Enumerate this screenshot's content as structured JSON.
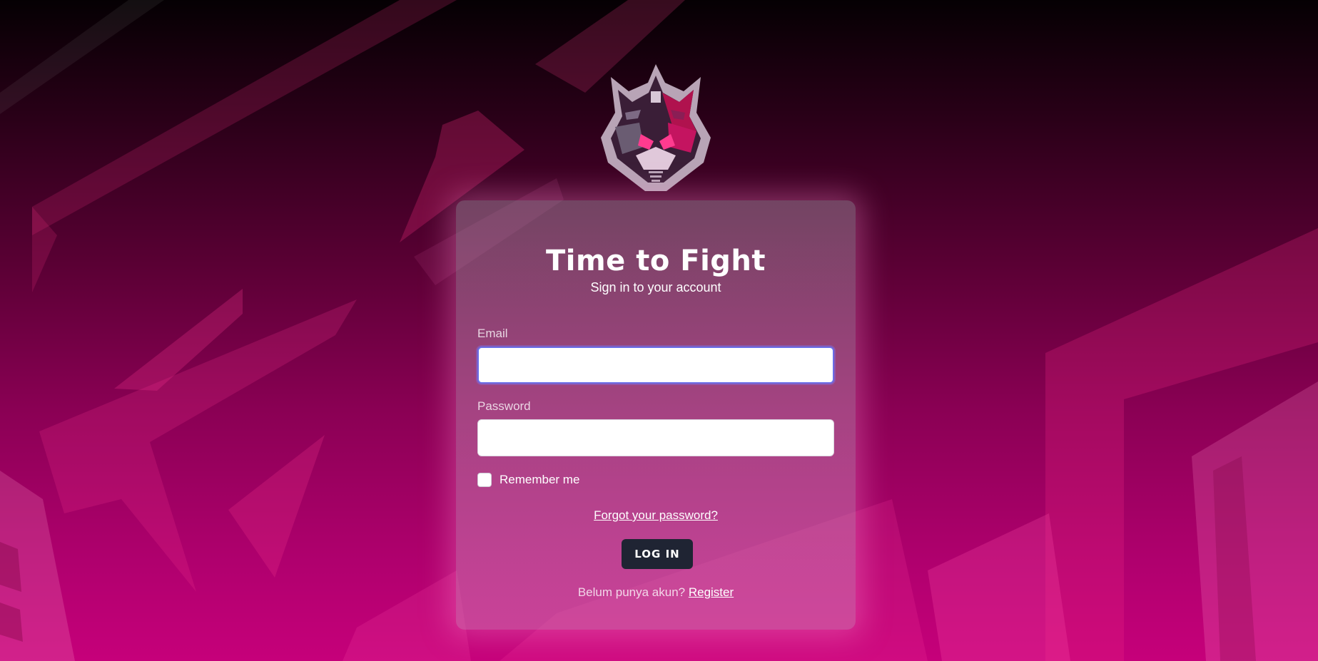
{
  "colors": {
    "background_top": "#050003",
    "background_bottom": "#c6007a",
    "button": "#1f2433",
    "focus_ring": "#6a6ee8"
  },
  "logo": {
    "icon": "robot-warrior-mask-logo"
  },
  "login_card": {
    "title": "Time to Fight",
    "subtitle": "Sign in to your account",
    "email": {
      "label": "Email",
      "value": "",
      "placeholder": ""
    },
    "password": {
      "label": "Password",
      "value": "",
      "placeholder": ""
    },
    "remember": {
      "label": "Remember me",
      "checked": false
    },
    "forgot_link": "Forgot your password?",
    "login_button": "LOG IN",
    "register_prompt": "Belum punya akun?",
    "register_link": "Register"
  }
}
